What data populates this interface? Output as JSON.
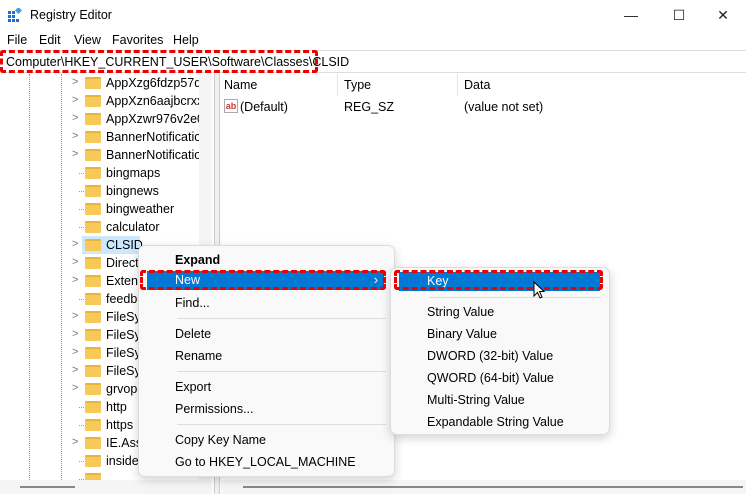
{
  "window": {
    "title": "Registry Editor",
    "minimize": "—",
    "maximize": "☐",
    "close": "✕"
  },
  "menubar": [
    "File",
    "Edit",
    "View",
    "Favorites",
    "Help"
  ],
  "address": "Computer\\HKEY_CURRENT_USER\\Software\\Classes\\CLSID",
  "highlight_color": "#e00000",
  "accent": "#0078d4",
  "tree": [
    {
      "label": "AppXzg6fdzp57dp",
      "expandable": true
    },
    {
      "label": "AppXzn6aajbcrxx",
      "expandable": true
    },
    {
      "label": "AppXzwr976v2e0",
      "expandable": true
    },
    {
      "label": "BannerNotificatio",
      "expandable": true
    },
    {
      "label": "BannerNotificatio",
      "expandable": true
    },
    {
      "label": "bingmaps",
      "expandable": false
    },
    {
      "label": "bingnews",
      "expandable": false
    },
    {
      "label": "bingweather",
      "expandable": false
    },
    {
      "label": "calculator",
      "expandable": false
    },
    {
      "label": "CLSID",
      "expandable": true,
      "selected": true
    },
    {
      "label": "Direct",
      "expandable": true
    },
    {
      "label": "Extens",
      "expandable": true
    },
    {
      "label": "feedb",
      "expandable": false
    },
    {
      "label": "FileSy",
      "expandable": true
    },
    {
      "label": "FileSy",
      "expandable": true
    },
    {
      "label": "FileSy",
      "expandable": true
    },
    {
      "label": "FileSy",
      "expandable": true
    },
    {
      "label": "grvop",
      "expandable": true
    },
    {
      "label": "http",
      "expandable": false
    },
    {
      "label": "https",
      "expandable": false
    },
    {
      "label": "IE.Ass",
      "expandable": true
    },
    {
      "label": "inside",
      "expandable": false
    },
    {
      "label": "",
      "expandable": false
    }
  ],
  "values": {
    "columns": [
      "Name",
      "Type",
      "Data"
    ],
    "rows": [
      {
        "name": "(Default)",
        "type": "REG_SZ",
        "data": "(value not set)",
        "icon": "ab"
      }
    ]
  },
  "context_menu": [
    "Expand",
    "New",
    "Find...",
    "Delete",
    "Rename",
    "Export",
    "Permissions...",
    "Copy Key Name",
    "Go to HKEY_LOCAL_MACHINE"
  ],
  "submenu": [
    "Key",
    "String Value",
    "Binary Value",
    "DWORD (32-bit) Value",
    "QWORD (64-bit) Value",
    "Multi-String Value",
    "Expandable String Value"
  ]
}
